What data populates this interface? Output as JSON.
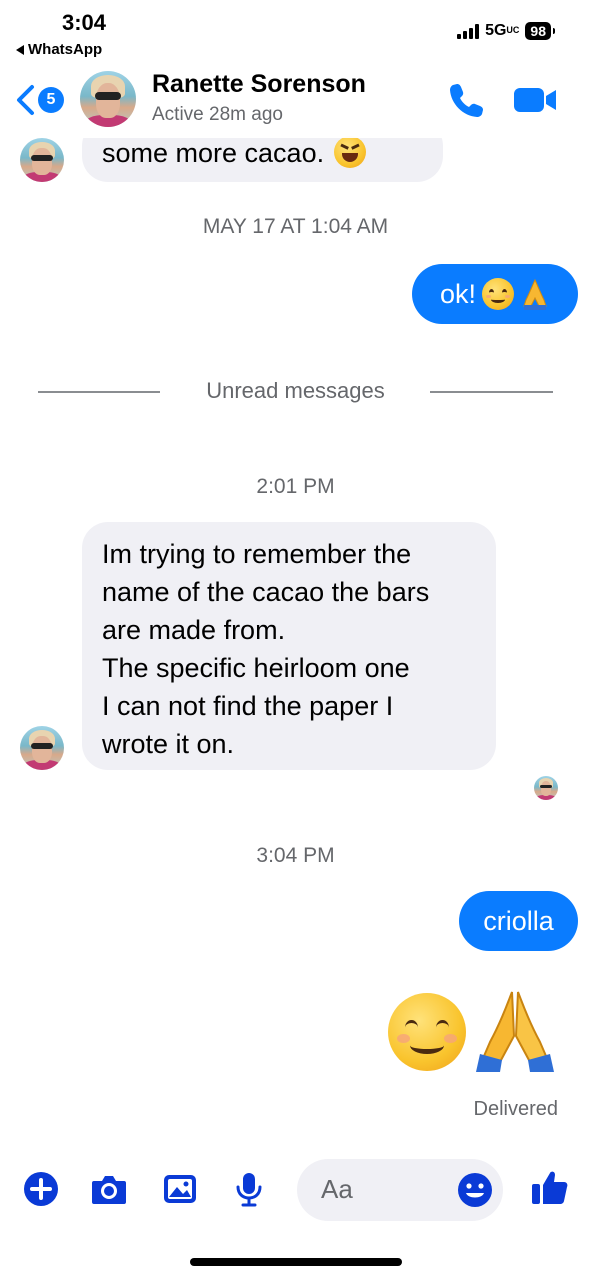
{
  "status_bar": {
    "time": "3:04",
    "back_app": "WhatsApp",
    "network": "5G",
    "network_suffix": "UC",
    "battery": "98"
  },
  "header": {
    "back_count": "5",
    "contact_name": "Ranette Sorenson",
    "contact_status": "Active 28m ago"
  },
  "conversation": {
    "partial_message": "some more cacao.",
    "timestamp_1": "MAY 17 AT 1:04 AM",
    "sent_1": "ok!",
    "unread_label": "Unread messages",
    "timestamp_2": "2:01 PM",
    "received_lines": [
      "Im trying to remember the",
      "name of the cacao the bars",
      "are made from.",
      "The specific heirloom one",
      "I can not find the paper I",
      "wrote it on."
    ],
    "timestamp_3": "3:04 PM",
    "sent_2": "criolla",
    "delivered": "Delivered"
  },
  "composer": {
    "placeholder": "Aa"
  },
  "colors": {
    "accent": "#0a7cff",
    "icon_blue": "#0a3ad6",
    "incoming_bubble": "#f0f0f5"
  }
}
